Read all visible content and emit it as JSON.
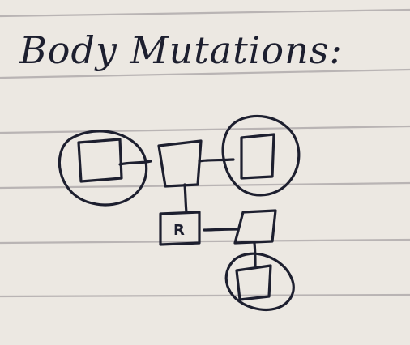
{
  "title": "Body Mutations:",
  "nodes": [
    {
      "id": "n1",
      "shape": "square",
      "circled": true,
      "label": ""
    },
    {
      "id": "n2",
      "shape": "square",
      "circled": false,
      "label": ""
    },
    {
      "id": "n3",
      "shape": "square",
      "circled": true,
      "label": ""
    },
    {
      "id": "n4",
      "shape": "square",
      "circled": false,
      "label": "R"
    },
    {
      "id": "n5",
      "shape": "square",
      "circled": false,
      "label": ""
    },
    {
      "id": "n6",
      "shape": "square",
      "circled": true,
      "label": ""
    }
  ],
  "edges": [
    {
      "from": "n1",
      "to": "n2"
    },
    {
      "from": "n2",
      "to": "n3"
    },
    {
      "from": "n2",
      "to": "n4"
    },
    {
      "from": "n4",
      "to": "n5"
    },
    {
      "from": "n5",
      "to": "n6"
    }
  ],
  "colors": {
    "paper": "#ece8e2",
    "ink": "#1d1f2f",
    "rule_lines": "#b9b4b4"
  }
}
